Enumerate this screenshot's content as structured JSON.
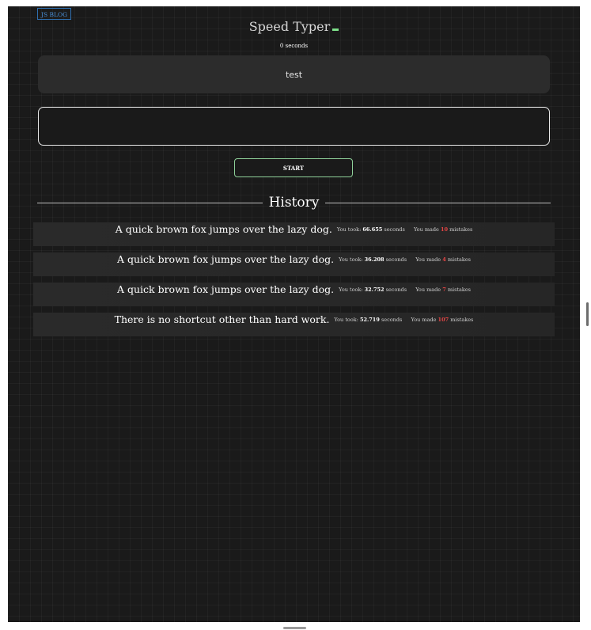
{
  "header": {
    "blog_link": "JS BLOG",
    "title": "Speed Typer",
    "timer_text": "0 seconds"
  },
  "main": {
    "quote_text": "test",
    "input_value": "",
    "input_placeholder": "",
    "start_label": "START"
  },
  "history": {
    "title": "History",
    "took_label": "You took:",
    "seconds_unit": "seconds",
    "made_label": "You made",
    "mistakes_unit": "mistakes",
    "entries": [
      {
        "sentence": "A quick brown fox jumps over the lazy dog.",
        "time": "66.655",
        "mistakes": "10"
      },
      {
        "sentence": "A quick brown fox jumps over the lazy dog.",
        "time": "36.208",
        "mistakes": "4"
      },
      {
        "sentence": "A quick brown fox jumps over the lazy dog.",
        "time": "32.752",
        "mistakes": "7"
      },
      {
        "sentence": "There is no shortcut other than hard work.",
        "time": "52.719",
        "mistakes": "107"
      }
    ]
  },
  "colors": {
    "background": "#1a1a1a",
    "panel": "#2c2c2c",
    "accent_green": "#8fd19a",
    "mistake_red": "#e64545",
    "link_blue": "#4a90d9"
  }
}
